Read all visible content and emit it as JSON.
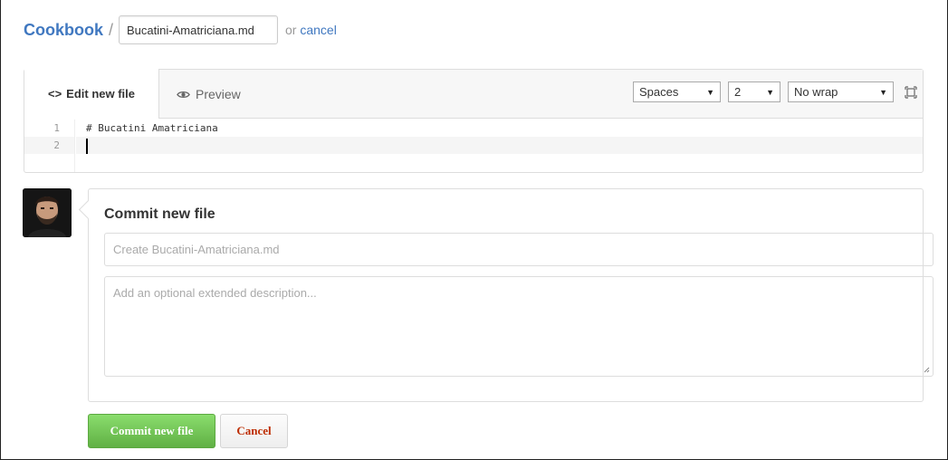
{
  "breadcrumb": {
    "repo": "Cookbook",
    "separator": "/",
    "filename_value": "Bucatini-Amatriciana.md",
    "or_text": "or",
    "cancel_link": "cancel"
  },
  "editor": {
    "tabs": [
      {
        "label": "Edit new file",
        "icon": "code-icon",
        "active": true
      },
      {
        "label": "Preview",
        "icon": "eye-icon",
        "active": false
      }
    ],
    "indent_mode": "Spaces",
    "indent_size": "2",
    "wrap_mode": "No wrap",
    "lines": [
      {
        "number": "1",
        "text": "# Bucatini Amatriciana"
      },
      {
        "number": "2",
        "text": ""
      }
    ]
  },
  "commit": {
    "title": "Commit new file",
    "summary_placeholder": "Create Bucatini-Amatriciana.md",
    "description_placeholder": "Add an optional extended description...",
    "commit_button": "Commit new file",
    "cancel_button": "Cancel"
  },
  "colors": {
    "link": "#4078c0",
    "commit_green": "#6cc644",
    "cancel_red": "#bd2c00"
  }
}
